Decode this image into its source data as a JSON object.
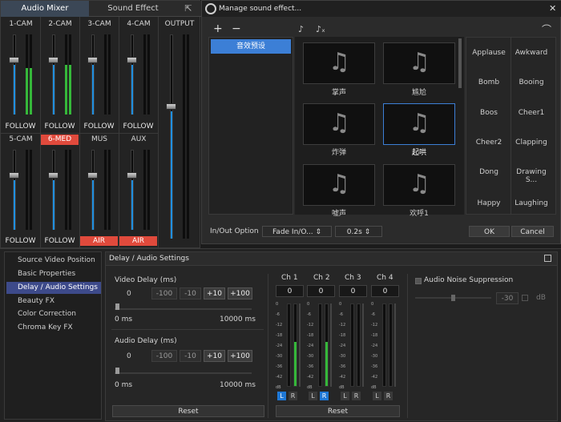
{
  "mixer": {
    "tabs": [
      "Audio Mixer",
      "Sound Effect"
    ],
    "channels_top": [
      {
        "name": "1-CAM",
        "button": "FOLLOW",
        "red": false
      },
      {
        "name": "2-CAM",
        "button": "FOLLOW",
        "red": false
      },
      {
        "name": "3-CAM",
        "button": "FOLLOW",
        "red": false
      },
      {
        "name": "4-CAM",
        "button": "FOLLOW",
        "red": false
      }
    ],
    "output": "OUTPUT",
    "channels_bottom": [
      {
        "name": "5-CAM",
        "button": "FOLLOW",
        "red": false
      },
      {
        "name": "6-MED",
        "button": "FOLLOW",
        "red": false,
        "name_red": true
      },
      {
        "name": "MUS",
        "button": "AIR",
        "red": true
      },
      {
        "name": "AUX",
        "button": "AIR",
        "red": true
      }
    ]
  },
  "dialog": {
    "title": "Manage sound effect...",
    "add": "+",
    "remove": "−",
    "category": "音效预设",
    "tiles": [
      "掌声",
      "尴尬",
      "炸弹",
      "起哄",
      "嘘声",
      "欢呼1"
    ],
    "effects": [
      [
        "Applause",
        "Awkward"
      ],
      [
        "Bomb",
        "Booing"
      ],
      [
        "Boos",
        "Cheer1"
      ],
      [
        "Cheer2",
        "Clapping"
      ],
      [
        "Dong",
        "Drawing S..."
      ],
      [
        "Happy",
        "Laughing"
      ]
    ],
    "inout_label": "In/Out Option",
    "inout_value": "Fade In/O...",
    "duration": "0.2s",
    "ok": "OK",
    "cancel": "Cancel"
  },
  "settings": {
    "menu": [
      "Source Video Position",
      "Basic Properties",
      "Delay / Audio Settings",
      "Beauty FX",
      "Color Correction",
      "Chroma Key FX"
    ],
    "panel_title": "Delay / Audio Settings",
    "video_delay": {
      "label": "Video Delay (ms)",
      "value": "0",
      "buttons": [
        "-100",
        "-10",
        "+10",
        "+100"
      ],
      "min": "0 ms",
      "max": "10000 ms",
      "level": 0
    },
    "audio_delay": {
      "label": "Audio Delay (ms)",
      "value": "0",
      "buttons": [
        "-100",
        "-10",
        "+10",
        "+100"
      ],
      "min": "0 ms",
      "max": "10000 ms",
      "level": 0
    },
    "reset": "Reset",
    "channels": [
      {
        "name": "Ch 1",
        "value": "0"
      },
      {
        "name": "Ch 2",
        "value": "0"
      },
      {
        "name": "Ch 3",
        "value": "0"
      },
      {
        "name": "Ch 4",
        "value": "0"
      }
    ],
    "scale": [
      "0",
      "-6",
      "-12",
      "-18",
      "-24",
      "-30",
      "-36",
      "-42",
      "-48",
      "dB"
    ],
    "lr": [
      "L",
      "R"
    ],
    "noise": {
      "label": "Audio Noise Suppression",
      "value": "-30",
      "unit": "dB"
    },
    "reset2": "Reset"
  },
  "colors": {
    "accent": "#3c7fd6",
    "red": "#e04a3c",
    "meter_green": "#35b83a",
    "meter_blue": "#1f8fe0"
  }
}
